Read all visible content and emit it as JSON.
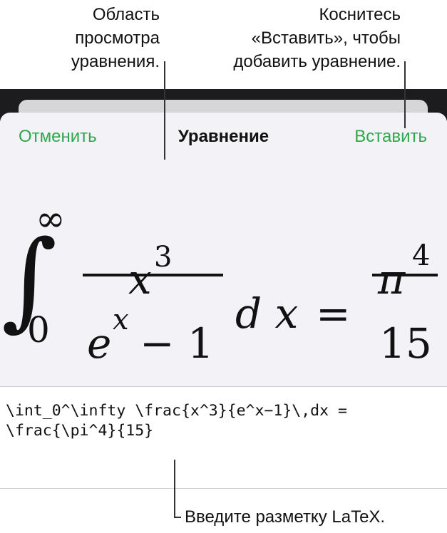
{
  "callouts": {
    "preview": [
      "Область",
      "просмотра",
      "уравнения."
    ],
    "insert": [
      "Коснитесь",
      "«Вставить», чтобы",
      "добавить уравнение."
    ],
    "latex": "Введите разметку LaTeX."
  },
  "sheet": {
    "cancel_label": "Отменить",
    "title": "Уравнение",
    "insert_label": "Вставить"
  },
  "equation": {
    "integral": "∫",
    "upper_limit": "∞",
    "lower_limit": "0",
    "numerator_base": "x",
    "numerator_exp": "3",
    "denominator_base": "e",
    "denominator_exp": "x",
    "denominator_rest": "− 1",
    "differential": "d x",
    "equals": "=",
    "rhs_numerator_base": "π",
    "rhs_numerator_exp": "4",
    "rhs_denominator": "15"
  },
  "latex": {
    "lines": [
      "\\int_0^\\infty \\frac{x^3}{e^x−1}\\,dx =",
      "\\frac{\\pi^4}{15}"
    ]
  },
  "colors": {
    "accent": "#2ea84a",
    "sheet_background": "#f2f2f7",
    "dark_band": "#1c1c1e"
  }
}
